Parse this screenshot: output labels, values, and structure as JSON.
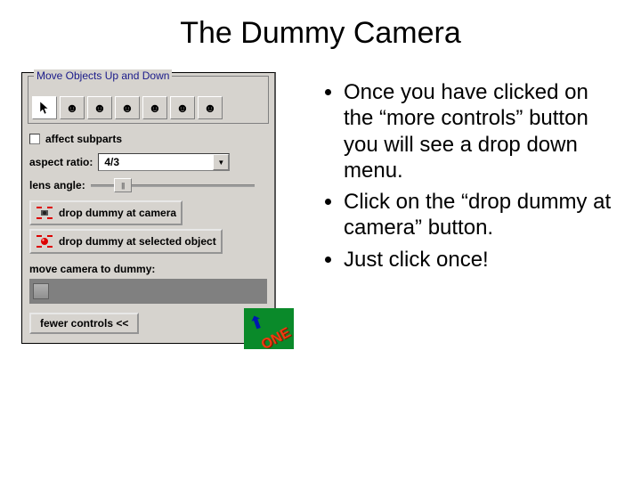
{
  "title": "The Dummy Camera",
  "panel": {
    "move_section_legend": "Move Objects Up and Down",
    "icons": [
      "cursor",
      "face",
      "face",
      "face",
      "face",
      "face",
      "face"
    ],
    "affect_subparts_label": "affect subparts",
    "aspect_ratio_label": "aspect ratio:",
    "aspect_ratio_value": "4/3",
    "lens_angle_label": "lens angle:",
    "drop_at_camera_label": "drop dummy at camera",
    "drop_at_selected_label": "drop dummy at selected object",
    "move_camera_label": "move camera to dummy:",
    "fewer_controls_label": "fewer controls  <<",
    "done_badge": "ONE"
  },
  "bullets": [
    "Once you have clicked on the “more controls” button you will see a drop down menu.",
    "Click on the “drop dummy at camera” button.",
    "Just click once!"
  ]
}
